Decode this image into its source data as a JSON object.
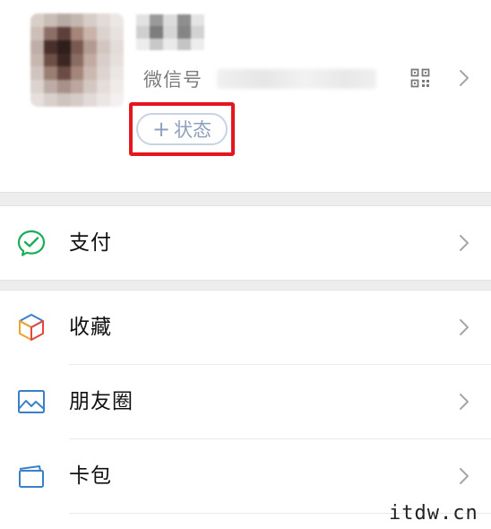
{
  "profile": {
    "wechat_id_label": "微信号",
    "status_plus": "+",
    "status_label": "状态",
    "qr_icon": "qr-code-icon",
    "chevron_icon": "chevron-right-icon",
    "highlight_color": "#e4161e"
  },
  "menu": {
    "items": [
      {
        "label": "支付",
        "icon": "pay-icon",
        "icon_color": "#1aad5a"
      },
      {
        "label": "收藏",
        "icon": "favorites-cube-icon",
        "icon_color": "#f0a32b"
      },
      {
        "label": "朋友圈",
        "icon": "moments-picture-icon",
        "icon_color": "#3a80c9"
      },
      {
        "label": "卡包",
        "icon": "card-wallet-icon",
        "icon_color": "#3a80c9"
      }
    ]
  },
  "watermark": "itdw.cn",
  "colors": {
    "background": "#ffffff",
    "group_gap": "#ededed",
    "chevron": "#a6a6a6",
    "status_text": "#8fa0bd"
  }
}
